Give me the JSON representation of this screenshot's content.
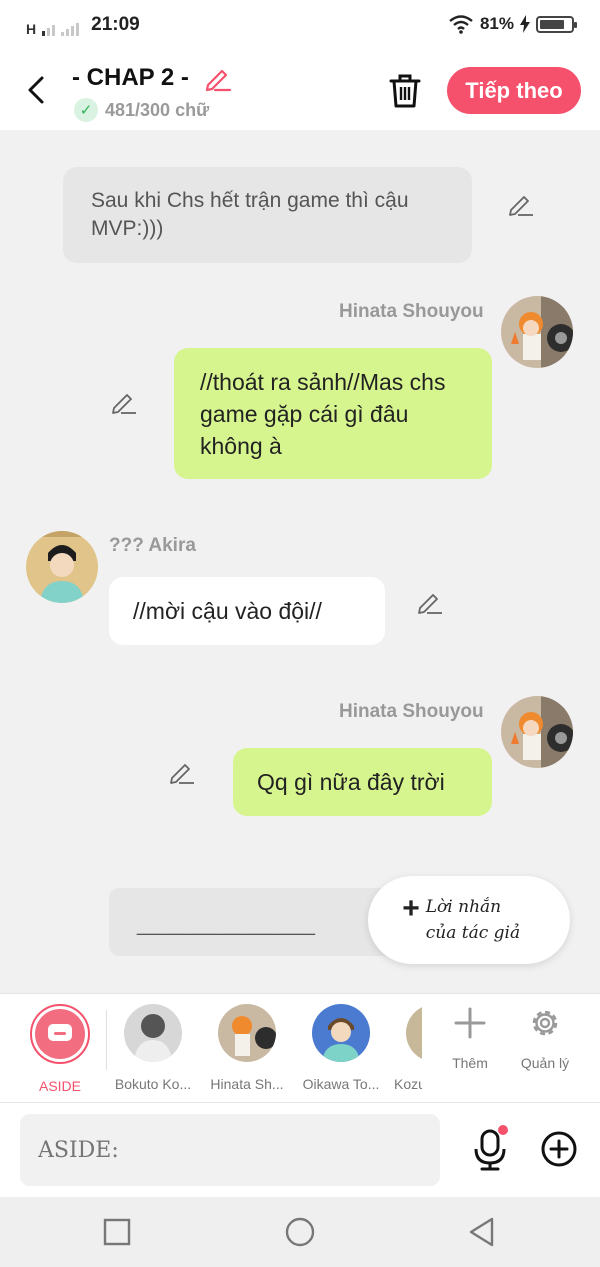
{
  "status_bar": {
    "network": "H",
    "time": "21:09",
    "battery": "81%",
    "battery_level": 0.81
  },
  "header": {
    "chapter_title": "- CHAP 2 -",
    "word_count": "481/300 chữ",
    "next_label": "Tiếp theo"
  },
  "messages": {
    "narration": "Sau khi Chs hết trận game thì cậu MVP:)))",
    "m1_name": "Hinata Shouyou",
    "m1_text": "//thoát ra sảnh//Mas chs game gặp cái gì đâu không à",
    "m2_name": "??? Akira",
    "m2_text": "//mời cậu vào đội//",
    "m3_name": "Hinata Shouyou",
    "m3_text": "Qq gì nữa đây trời"
  },
  "draft_text": "________________",
  "author_note_label": "Lời nhắn của tác giả",
  "characters": [
    {
      "label": "ASIDE",
      "active": true
    },
    {
      "label": "Bokuto Ko..."
    },
    {
      "label": "Hinata Sh..."
    },
    {
      "label": "Oikawa To..."
    },
    {
      "label": "Kozu"
    }
  ],
  "tools": {
    "add_label": "Thêm",
    "manage_label": "Quản lý"
  },
  "composer": {
    "placeholder": "ASIDE:"
  },
  "colors": {
    "accent": "#f5516c",
    "bubble_green": "#d6f58e"
  },
  "icons": [
    "signal-icon",
    "wifi-icon",
    "battery-icon",
    "back-icon",
    "edit-icon",
    "check-icon",
    "trash-icon",
    "plus-icon",
    "gear-icon",
    "mic-icon",
    "add-circle-icon",
    "nav-square-icon",
    "nav-circle-icon",
    "nav-triangle-icon"
  ]
}
